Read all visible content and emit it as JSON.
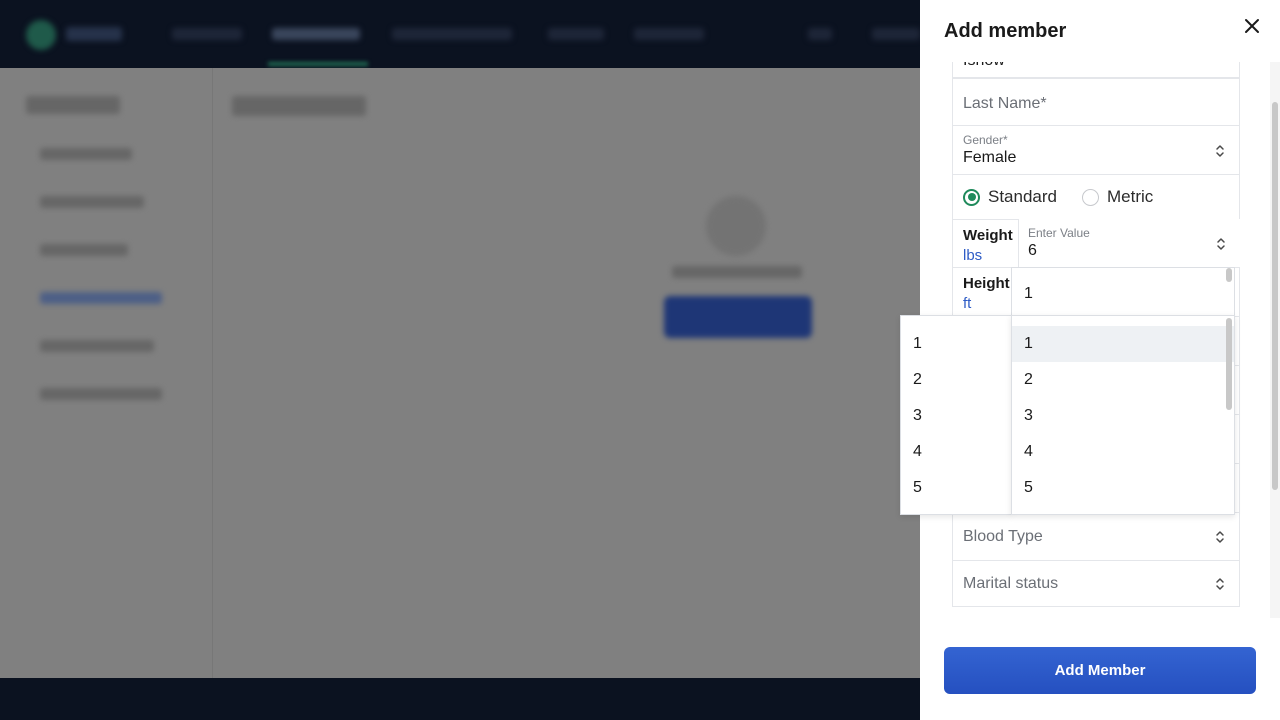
{
  "drawer": {
    "title": "Add member",
    "first_name_value": "Ishow",
    "last_name_placeholder": "Last Name*",
    "gender": {
      "label": "Gender*",
      "value": "Female"
    },
    "units": {
      "standard": "Standard",
      "metric": "Metric",
      "selected": "Standard"
    },
    "weight": {
      "label": "Weight",
      "unit": "lbs",
      "value_label": "Enter Value",
      "value": "6"
    },
    "height": {
      "label": "Height",
      "unit": "ft",
      "feet_value": "1"
    },
    "blood_type_placeholder": "Blood Type",
    "marital_status_placeholder": "Marital status",
    "submit_label": "Add Member"
  },
  "dropdowns": {
    "height_inches_options": [
      "1",
      "2",
      "3",
      "4",
      "5"
    ],
    "height_feet_options": [
      "1",
      "2",
      "3",
      "4",
      "5"
    ],
    "highlighted": "1"
  },
  "colors": {
    "accent_green": "#1f8a5b",
    "link_blue": "#2e5cc6",
    "button_blue": "#2d5ccc"
  }
}
